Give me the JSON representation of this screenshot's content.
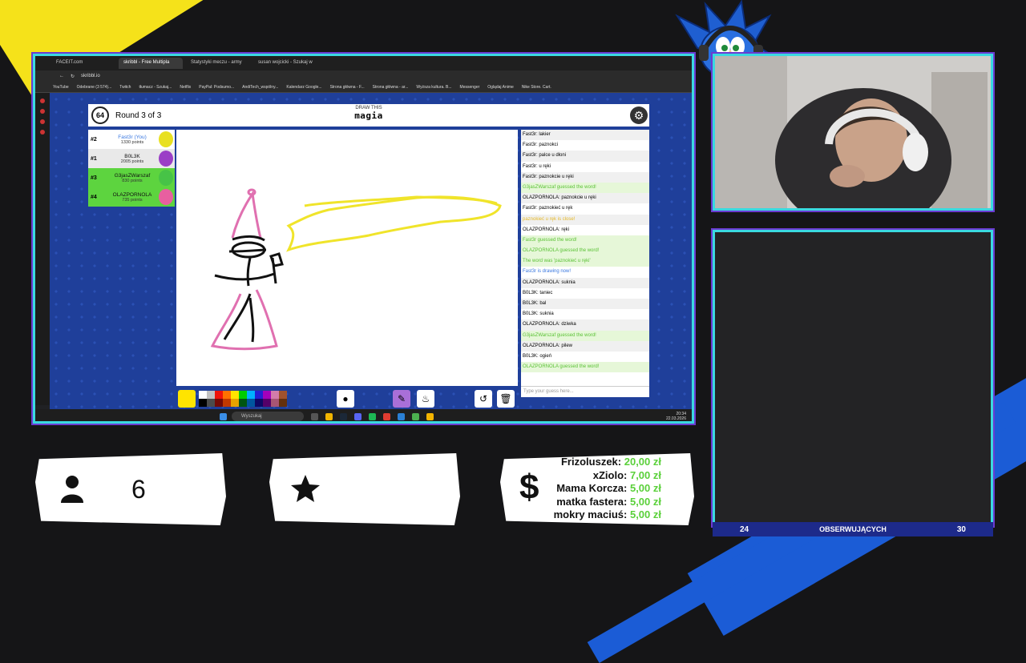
{
  "browser": {
    "tabs": [
      "FACEIT.com",
      "skribbl - Free Multipla",
      "Statystyki meczu - army",
      "susan wojcicki - Szukaj w"
    ],
    "url": "skribbl.io",
    "bookmarks": [
      "YouTube",
      "Odebrane (3 574)...",
      "Twitch",
      "tłumacz - Szukaj...",
      "Netflix",
      "PayPal: Podsumo...",
      "AndiTech_wspólny...",
      "Kalendarz Google...",
      "Strona główna - F...",
      "Strona główna - ar...",
      "Wyższa kultura. B...",
      "Messenger",
      "Oglądaj Anime",
      "Nike Store. Cart."
    ]
  },
  "game": {
    "timer": "64",
    "round": "Round 3 of 3",
    "word_label": "DRAW THIS",
    "word": "magia",
    "players": [
      {
        "rank": "#2",
        "name": "Fast3r (You)",
        "points": "1330 points",
        "bg": "#ffffff",
        "avatar": "#e8e020",
        "name_color": "#3a78e0"
      },
      {
        "rank": "#1",
        "name": "B0L3K",
        "points": "2005 points",
        "bg": "#e9e9e9",
        "avatar": "#9b3fc6",
        "name_color": "#111111"
      },
      {
        "rank": "#3",
        "name": "G3jasZWarszaf",
        "points": "830 points",
        "bg": "#5dd43f",
        "avatar": "#47c347",
        "name_color": "#111111"
      },
      {
        "rank": "#4",
        "name": "OLAZPORNOLA",
        "points": "735 points",
        "bg": "#5dd43f",
        "avatar": "#e85fa0",
        "name_color": "#111111"
      }
    ],
    "chat": [
      {
        "text": "Fast3r: lakier",
        "cls": ""
      },
      {
        "text": "Fast3r: paznokci",
        "cls": ""
      },
      {
        "text": "Fast3r: palce u dłoni",
        "cls": ""
      },
      {
        "text": "Fast3r: u ręki",
        "cls": ""
      },
      {
        "text": "Fast3r: paznokcie u ręki",
        "cls": ""
      },
      {
        "text": "G3jasZWarszaf guessed the word!",
        "cls": "green"
      },
      {
        "text": "OLAZPORNOLA: paznokcie u ręki",
        "cls": ""
      },
      {
        "text": "Fast3r: paznokieć u ręk",
        "cls": ""
      },
      {
        "text": "paznokieć u ręk is close!",
        "cls": "yellow"
      },
      {
        "text": "OLAZPORNOLA: ręki",
        "cls": ""
      },
      {
        "text": "Fast3r guessed the word!",
        "cls": "green"
      },
      {
        "text": "OLAZPORNOLA guessed the word!",
        "cls": "green"
      },
      {
        "text": "The word was 'paznokieć u ręki'",
        "cls": "green"
      },
      {
        "text": "Fast3r is drawing now!",
        "cls": "blue"
      },
      {
        "text": "OLAZPORNOLA: suknia",
        "cls": ""
      },
      {
        "text": "B0L3K: taniec",
        "cls": ""
      },
      {
        "text": "B0L3K: bal",
        "cls": ""
      },
      {
        "text": "B0L3K: suknia",
        "cls": ""
      },
      {
        "text": "OLAZPORNOLA: dziwka",
        "cls": ""
      },
      {
        "text": "G3jasZWarszaf guessed the word!",
        "cls": "green"
      },
      {
        "text": "OLAZPORNOLA: pilew",
        "cls": ""
      },
      {
        "text": "B0L3K: ogień",
        "cls": ""
      },
      {
        "text": "OLAZPORNOLA guessed the word!",
        "cls": "green"
      }
    ],
    "chat_placeholder": "Type your guess here...",
    "palette": [
      "#ffffff",
      "#c1c1c1",
      "#ef130b",
      "#ff7100",
      "#ffe400",
      "#00cc00",
      "#00b2ff",
      "#231fd3",
      "#a300ba",
      "#d37caa",
      "#a0522d",
      "#000000",
      "#4c4c4c",
      "#740b07",
      "#c23800",
      "#e8a200",
      "#005510",
      "#00569e",
      "#0e0865",
      "#550069",
      "#a75574",
      "#63300d"
    ]
  },
  "taskbar": {
    "search": "Wyszukaj",
    "time": "20:34",
    "date": "22.03.2026"
  },
  "overlay": {
    "viewers": "6",
    "dollar": "$",
    "donations": [
      {
        "name": "Frizoluszek:",
        "amount": "20,00 zł"
      },
      {
        "name": "xZiolo:",
        "amount": "7,00 zł"
      },
      {
        "name": "Mama Korcza:",
        "amount": "5,00 zł"
      },
      {
        "name": "matka fastera:",
        "amount": "5,00 zł"
      },
      {
        "name": "mokry maciuś:",
        "amount": "5,00 zł"
      }
    ],
    "followers_current": "24",
    "followers_label": "OBSERWUJĄCYCH",
    "followers_goal": "30"
  }
}
